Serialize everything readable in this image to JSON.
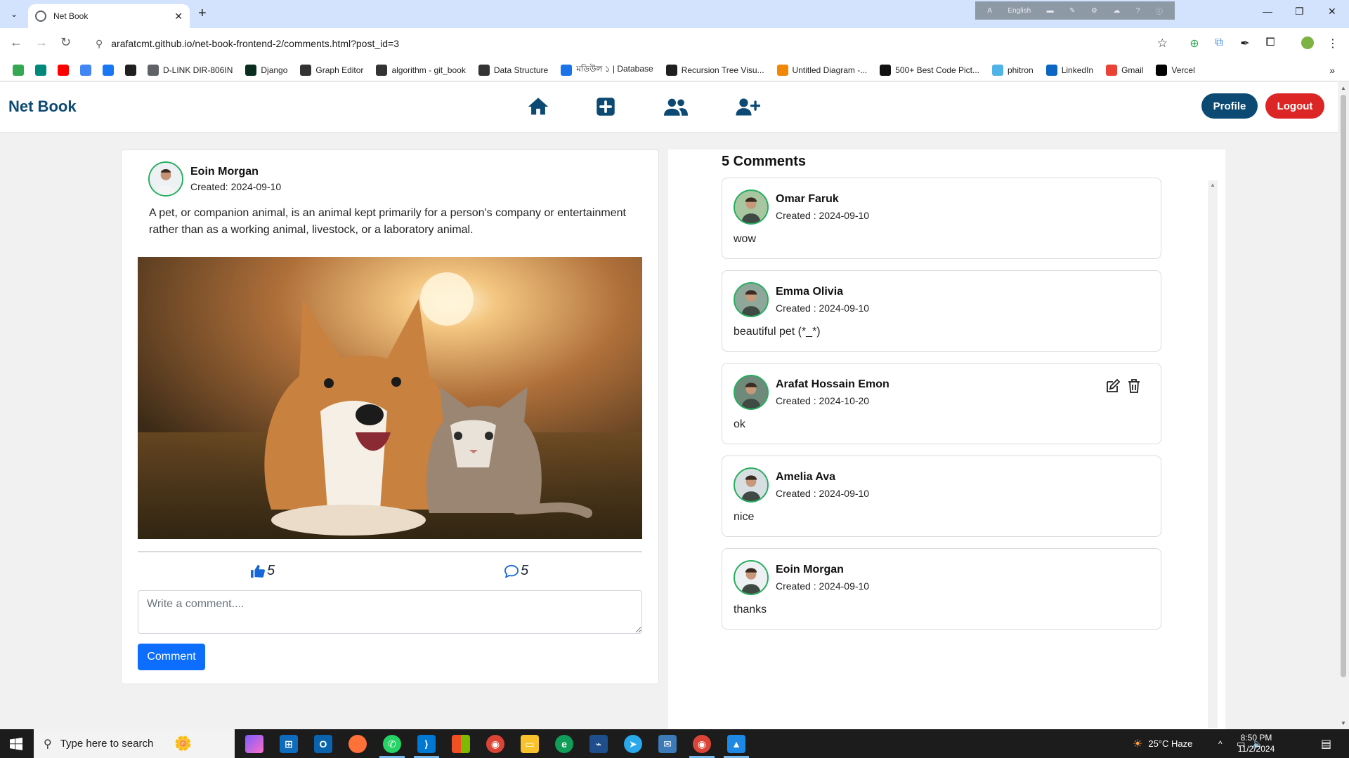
{
  "browser": {
    "tab_title": "Net Book",
    "url": "arafatcmt.github.io/net-book-frontend-2/comments.html?post_id=3",
    "ime_label": "English",
    "bookmarks": [
      {
        "label": "",
        "icon": "google-drive-icon",
        "color": "#34a853"
      },
      {
        "label": "",
        "icon": "google-meet-icon",
        "color": "#00897b"
      },
      {
        "label": "",
        "icon": "youtube-icon",
        "color": "#ff0000"
      },
      {
        "label": "",
        "icon": "chromecast-icon",
        "color": "#4285f4"
      },
      {
        "label": "",
        "icon": "facebook-icon",
        "color": "#1877f2"
      },
      {
        "label": "",
        "icon": "github-icon",
        "color": "#1f1f1f"
      },
      {
        "label": "D-LINK DIR-806IN",
        "icon": "globe-icon",
        "color": "#5f6368"
      },
      {
        "label": "Django",
        "icon": "d-icon",
        "color": "#092e20"
      },
      {
        "label": "Graph Editor",
        "icon": "graph-icon",
        "color": "#333333"
      },
      {
        "label": "algorithm - git_book",
        "icon": "a-icon",
        "color": "#333333"
      },
      {
        "label": "Data Structure",
        "icon": "d-icon",
        "color": "#333333"
      },
      {
        "label": "মডিউল ১ | Database",
        "icon": "doc-icon",
        "color": "#1a73e8"
      },
      {
        "label": "Recursion Tree Visu...",
        "icon": "tree-icon",
        "color": "#1f1f1f"
      },
      {
        "label": "Untitled Diagram -...",
        "icon": "drawio-icon",
        "color": "#f08705"
      },
      {
        "label": "500+ Best Code Pict...",
        "icon": "unsplash-icon",
        "color": "#111111"
      },
      {
        "label": "phitron",
        "icon": "phitron-icon",
        "color": "#4fb3e8"
      },
      {
        "label": "LinkedIn",
        "icon": "linkedin-icon",
        "color": "#0a66c2"
      },
      {
        "label": "Gmail",
        "icon": "gmail-icon",
        "color": "#ea4335"
      },
      {
        "label": "Vercel",
        "icon": "vercel-icon",
        "color": "#000000"
      }
    ]
  },
  "app": {
    "brand": "Net Book",
    "nav": [
      "home-icon",
      "add-post-icon",
      "friends-icon",
      "add-friend-icon"
    ],
    "profile_label": "Profile",
    "logout_label": "Logout",
    "brand_color": "#0c4a74",
    "logout_color": "#dc2626"
  },
  "post": {
    "author": "Eoin Morgan",
    "created": "Created: 2024-09-10",
    "text": "A pet, or companion animal, is an animal kept primarily for a person's company or entertainment rather than as a working animal, livestock, or a laboratory animal.",
    "image": "corgi-and-kitten-photo",
    "likes": "5",
    "comments": "5",
    "comment_placeholder": "Write a comment....",
    "comment_button": "Comment"
  },
  "comments": {
    "title": "5 Comments",
    "items": [
      {
        "name": "Omar Faruk",
        "created": "Created : 2024-09-10",
        "text": "wow",
        "editable": false
      },
      {
        "name": "Emma Olivia",
        "created": "Created : 2024-09-10",
        "text": "beautiful pet (*_*)",
        "editable": false
      },
      {
        "name": "Arafat Hossain Emon",
        "created": "Created : 2024-10-20",
        "text": "ok",
        "editable": true
      },
      {
        "name": "Amelia Ava",
        "created": "Created : 2024-09-10",
        "text": "nice",
        "editable": false
      },
      {
        "name": "Eoin Morgan",
        "created": "Created : 2024-09-10",
        "text": "thanks",
        "editable": false
      }
    ]
  },
  "taskbar": {
    "search_placeholder": "Type here to search",
    "weather": "25°C  Haze",
    "time": "8:50 PM",
    "date": "11/2/2024"
  }
}
